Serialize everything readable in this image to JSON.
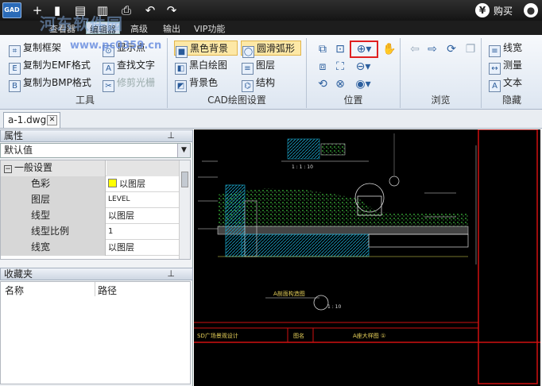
{
  "app": {
    "logo": "GAD"
  },
  "quick_access": [
    {
      "name": "new-file-icon",
      "glyph": "+"
    },
    {
      "name": "open-file-icon",
      "glyph": "▮"
    },
    {
      "name": "save-icon",
      "glyph": "▤"
    },
    {
      "name": "save-as-icon",
      "glyph": "▥"
    },
    {
      "name": "print-icon",
      "glyph": "⎙"
    },
    {
      "name": "undo-icon",
      "glyph": "↶"
    },
    {
      "name": "redo-icon",
      "glyph": "↷"
    }
  ],
  "top_right": {
    "buy_label": "购买"
  },
  "ribbon_tabs": [
    "查看器",
    "编辑器",
    "高级",
    "输出",
    "VIP功能"
  ],
  "groups": {
    "tools": {
      "label": "工具",
      "items": [
        {
          "label": "复制框架",
          "icon": "crop-icon"
        },
        {
          "label": "复制为EMF格式",
          "icon": "emf-icon"
        },
        {
          "label": "复制为BMP格式",
          "icon": "bmp-icon"
        },
        {
          "label": "显示点",
          "icon": "show-points-icon"
        },
        {
          "label": "查找文字",
          "icon": "find-text-icon"
        },
        {
          "label": "修剪光栅",
          "icon": "trim-raster-icon"
        }
      ]
    },
    "cad_settings": {
      "label": "CAD绘图设置",
      "items": [
        {
          "label": "黑色背景",
          "icon": "black-bg-icon"
        },
        {
          "label": "圆滑弧形",
          "icon": "smooth-arc-icon"
        },
        {
          "label": "黑白绘图",
          "icon": "black-white-icon"
        },
        {
          "label": "图层",
          "icon": "layers-icon"
        },
        {
          "label": "背景色",
          "icon": "bg-color-icon"
        },
        {
          "label": "结构",
          "icon": "structure-icon"
        }
      ]
    },
    "position": {
      "label": "位置"
    },
    "browse": {
      "label": "浏览"
    },
    "hide": {
      "label": "隐藏",
      "items": [
        {
          "label": "线宽",
          "icon": "line-width-icon"
        },
        {
          "label": "测量",
          "icon": "measure-icon"
        },
        {
          "label": "文本",
          "icon": "text-icon"
        }
      ]
    }
  },
  "doc_tab": {
    "label": "a-1.dwg"
  },
  "properties": {
    "title": "属性",
    "dropdown_value": "默认值",
    "group_label": "一般设置",
    "rows": [
      {
        "key": "色彩",
        "value": "以图层",
        "swatch": "#ffff00"
      },
      {
        "key": "图层",
        "value": "LEVEL"
      },
      {
        "key": "线型",
        "value": "以图层"
      },
      {
        "key": "线型比例",
        "value": "1"
      },
      {
        "key": "线宽",
        "value": "以图层"
      }
    ]
  },
  "favorites": {
    "title": "收藏夹",
    "col_name": "名称",
    "col_path": "路径"
  },
  "watermark": {
    "text1": "河东软件园",
    "text2": "www.pc0359.cn"
  },
  "drawing": {
    "title1": "A剖面构造图",
    "scale1": "1 : 10",
    "scale_top": "1 : 1 : 10",
    "title_block_left": "SD广场景观设计",
    "title_block_mid": "图名",
    "title_block_right": "A座大样图 ①"
  }
}
